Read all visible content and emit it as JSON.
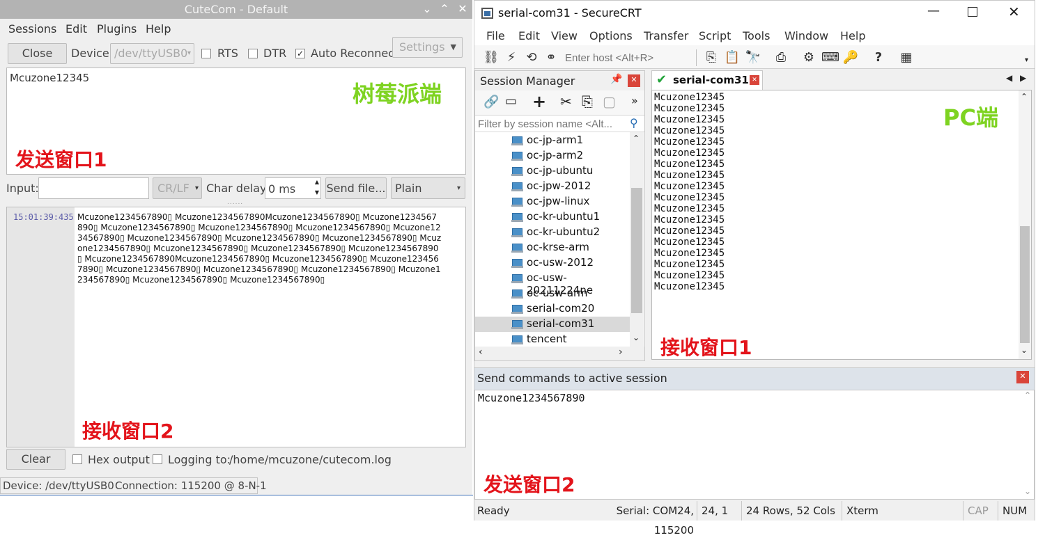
{
  "cutecom": {
    "title": "CuteCom - Default",
    "menu": [
      "Sessions",
      "Edit",
      "Plugins",
      "Help"
    ],
    "close_label": "Close",
    "device_label": "Device:",
    "device_value": "/dev/ttyUSB0",
    "rts_label": "RTS",
    "dtr_label": "DTR",
    "auto_reconnect_label": "Auto Reconnect",
    "auto_reconnect_checked": true,
    "settings_label": "Settings",
    "send_window_text": "Mcuzone12345",
    "overlay_pi": "树莓派端",
    "overlay_send1": "发送窗口1",
    "input_label": "Input:",
    "input_value": "",
    "line_end": "CR/LF",
    "char_delay_label": "Char delay:",
    "char_delay_value": "0 ms",
    "send_file_label": "Send file...",
    "format_value": "Plain",
    "recv_timestamp": "15:01:39:435",
    "recv_lines": [
      "Mcuzone1234567890▯ Mcuzone1234567890Mcuzone1234567890▯ Mcuzone1234567",
      "890▯ Mcuzone1234567890▯ Mcuzone1234567890▯ Mcuzone1234567890▯ Mcuzone12",
      "34567890▯ Mcuzone1234567890▯ Mcuzone1234567890▯ Mcuzone1234567890▯ Mcuz",
      "one1234567890▯ Mcuzone1234567890▯ Mcuzone1234567890▯ Mcuzone1234567890",
      "▯ Mcuzone1234567890Mcuzone1234567890▯ Mcuzone1234567890▯ Mcuzone123456",
      "7890▯ Mcuzone1234567890▯ Mcuzone1234567890▯ Mcuzone1234567890▯ Mcuzone1",
      "234567890▯ Mcuzone1234567890▯ Mcuzone1234567890▯"
    ],
    "overlay_recv2": "接收窗口2",
    "clear_label": "Clear",
    "hex_output_label": "Hex output",
    "logging_label": "Logging to:",
    "log_path": "/home/mcuzone/cutecom.log",
    "status_device": "Device:  /dev/ttyUSB0",
    "status_connection": "Connection:  115200 @ 8-N-1"
  },
  "securecrt": {
    "title": "serial-com31 - SecureCRT",
    "menu": [
      "File",
      "Edit",
      "View",
      "Options",
      "Transfer",
      "Script",
      "Tools",
      "Window",
      "Help"
    ],
    "host_placeholder": "Enter host <Alt+R>",
    "session_manager_title": "Session Manager",
    "filter_placeholder": "Filter by session name <Alt...",
    "sessions": [
      "oc-jp-arm1",
      "oc-jp-arm2",
      "oc-jp-ubuntu",
      "oc-jpw-2012",
      "oc-jpw-linux",
      "oc-kr-ubuntu1",
      "oc-kr-ubuntu2",
      "oc-krse-arm",
      "oc-usw-2012",
      "oc-usw-20211224ne",
      "oc-usw-arm",
      "serial-com20",
      "serial-com31",
      "tencent"
    ],
    "selected_session": "serial-com31",
    "tab_label": "serial-com31",
    "recv_lines": [
      "Mcuzone12345",
      "Mcuzone12345",
      "Mcuzone12345",
      "Mcuzone12345",
      "Mcuzone12345",
      "Mcuzone12345",
      "Mcuzone12345",
      "Mcuzone12345",
      "Mcuzone12345",
      "Mcuzone12345",
      "Mcuzone12345",
      "Mcuzone12345",
      "Mcuzone12345",
      "Mcuzone12345",
      "Mcuzone12345",
      "Mcuzone12345",
      "Mcuzone12345",
      "Mcuzone12345"
    ],
    "overlay_pc": "PC端",
    "overlay_recv1": "接收窗口1",
    "send_panel_title": "Send commands to active session",
    "send_text": "Mcuzone1234567890",
    "overlay_send2": "发送窗口2",
    "status": {
      "ready": "Ready",
      "serial": "Serial: COM24, 115200",
      "cursor": "24,   1",
      "size": "24 Rows, 52 Cols",
      "term": "Xterm",
      "cap": "CAP",
      "num": "NUM"
    }
  },
  "colors": {
    "overlay_red": "#e3141b",
    "overlay_green": "#7ed321",
    "selected_row": "#d9d9d9"
  }
}
